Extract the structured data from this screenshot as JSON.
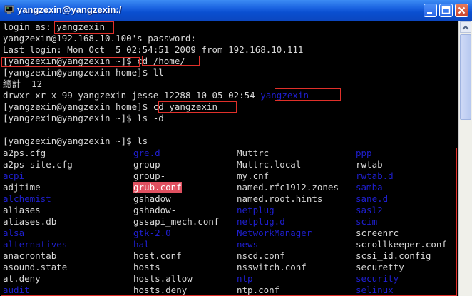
{
  "window": {
    "title": "yangzexin@yangzexin:/",
    "icon": "putty-terminal-icon",
    "controls": [
      "minimize-icon",
      "maximize-icon",
      "close-icon"
    ],
    "accent": "#0a4fd0"
  },
  "terminal": {
    "lines": [
      "login as: yangzexin",
      "yangzexin@192.168.10.100's password:",
      "Last login: Mon Oct  5 02:54:51 2009 from 192.168.10.111",
      "[yangzexin@yangzexin ~]$ cd /home/",
      "[yangzexin@yangzexin home]$ ll",
      "總計  12",
      "drwxr-xr-x 99 yangzexin jesse 12288 10-05 02:54 yangzexin",
      "[yangzexin@yangzexin home]$ cd yangzexin",
      "[yangzexin@yangzexin ~]$ ls -d",
      "",
      "[yangzexin@yangzexin ~]$ ls"
    ],
    "listing": {
      "rows": [
        [
          "a2ps.cfg",
          "gre.d",
          "Muttrc",
          "ppp"
        ],
        [
          "a2ps-site.cfg",
          "group",
          "Muttrc.local",
          "rwtab"
        ],
        [
          "acpi",
          "group-",
          "my.cnf",
          "rwtab.d"
        ],
        [
          "adjtime",
          "grub.conf",
          "named.rfc1912.zones",
          "samba"
        ],
        [
          "alchemist",
          "gshadow",
          "named.root.hints",
          "sane.d"
        ],
        [
          "aliases",
          "gshadow-",
          "netplug",
          "sasl2"
        ],
        [
          "aliases.db",
          "gssapi_mech.conf",
          "netplug.d",
          "scim"
        ],
        [
          "alsa",
          "gtk-2.0",
          "NetworkManager",
          "screenrc"
        ],
        [
          "alternatives",
          "hal",
          "news",
          "scrollkeeper.conf"
        ],
        [
          "anacrontab",
          "host.conf",
          "nscd.conf",
          "scsi_id.config"
        ],
        [
          "asound.state",
          "hosts",
          "nsswitch.conf",
          "securetty"
        ],
        [
          "at.deny",
          "hosts.allow",
          "ntp",
          "security"
        ],
        [
          "audit",
          "hosts.deny",
          "ntp.conf",
          "selinux"
        ]
      ],
      "blue_cells": [
        [
          0,
          1
        ],
        [
          0,
          3
        ],
        [
          2,
          0
        ],
        [
          2,
          3
        ],
        [
          3,
          3
        ],
        [
          4,
          0
        ],
        [
          4,
          3
        ],
        [
          5,
          2
        ],
        [
          5,
          3
        ],
        [
          6,
          2
        ],
        [
          6,
          3
        ],
        [
          7,
          0
        ],
        [
          7,
          1
        ],
        [
          7,
          2
        ],
        [
          8,
          0
        ],
        [
          8,
          1
        ],
        [
          8,
          2
        ],
        [
          11,
          2
        ],
        [
          11,
          3
        ],
        [
          12,
          0
        ],
        [
          12,
          3
        ]
      ],
      "highlight_cell": [
        3,
        1
      ]
    },
    "colors": {
      "foreground": "#d8d8d8",
      "background": "#000000",
      "directory": "#1f1fd0",
      "highlight": "#e05060",
      "annotation_box": "#e0302a"
    }
  }
}
